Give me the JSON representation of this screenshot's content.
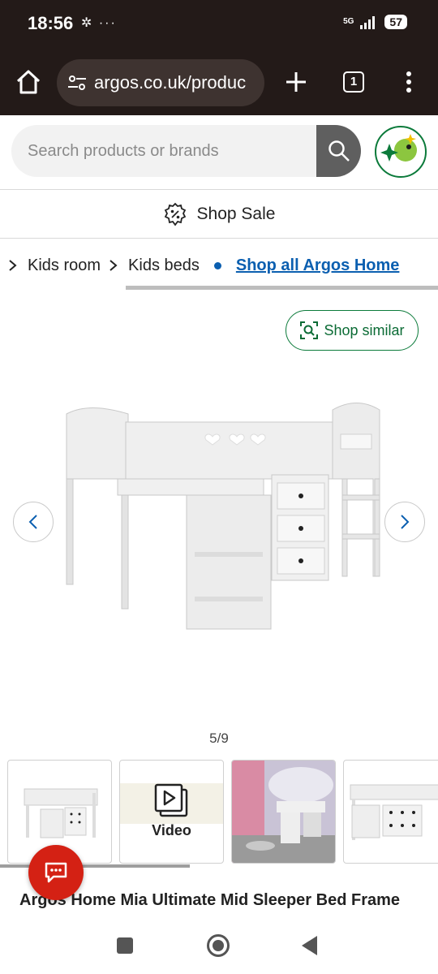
{
  "status": {
    "time": "18:56",
    "notif_icons": "✲ ···",
    "network": "5G",
    "battery": "57"
  },
  "browser": {
    "url": "argos.co.uk/produc",
    "tab_count": "1"
  },
  "search": {
    "placeholder": "Search products or brands"
  },
  "sale": {
    "label": "Shop Sale"
  },
  "breadcrumbs": {
    "items": [
      "Kids room",
      "Kids beds"
    ],
    "shop_all": "Shop all Argos Home"
  },
  "product": {
    "shop_similar": "Shop similar",
    "counter": "5/9",
    "video_label": "Video",
    "title": "Argos Home Mia Ultimate Mid Sleeper Bed Frame"
  },
  "colors": {
    "brand_green": "#0b7a3a",
    "link_blue": "#0b5fb0",
    "chat_red": "#d42114"
  }
}
